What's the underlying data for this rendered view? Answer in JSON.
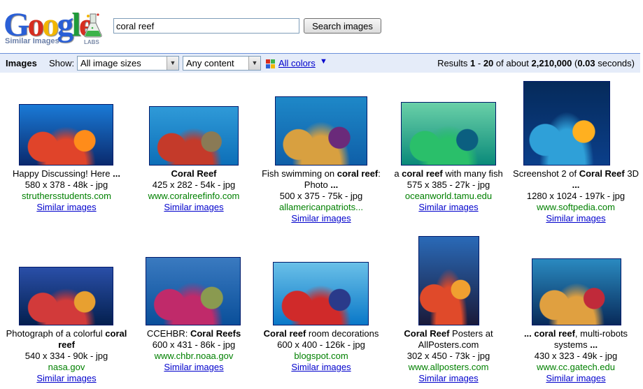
{
  "logo": {
    "word": [
      "G",
      "o",
      "o",
      "g",
      "l",
      "e"
    ],
    "colors": [
      "#2a5fd6",
      "#d62d20",
      "#f2b600",
      "#2a5fd6",
      "#1f9b3a",
      "#d62d20"
    ],
    "subtitle": "Similar Images",
    "labs": "LABS"
  },
  "search": {
    "query": "coral reef",
    "button": "Search images"
  },
  "toolbar": {
    "title": "Images",
    "show_label": "Show:",
    "size_select": "All image sizes",
    "content_select": "Any content",
    "colors_link": "All colors",
    "results_prefix": "Results ",
    "results_from": "1",
    "results_dash": " - ",
    "results_to": "20",
    "results_of": " of about ",
    "results_total": "2,210,000",
    "results_time_open": " (",
    "results_time": "0.03",
    "results_time_close": " seconds)"
  },
  "results": [
    {
      "title": "Happy Discussing! Here ...",
      "meta": "580 x 378 - 48k - jpg",
      "domain": "struthersstudents.com",
      "similar": "Similar images",
      "palette": [
        "#0a2a6e",
        "#e0442a",
        "#ff8c1a",
        "#1a7ad6"
      ]
    },
    {
      "title": "Coral Reef",
      "meta": "425 x 282 - 54k - jpg",
      "domain": "www.coralreefinfo.com",
      "similar": "Similar images",
      "palette": [
        "#0d6fb8",
        "#c43a2a",
        "#8a7a55",
        "#2f9ad8"
      ]
    },
    {
      "title": "Fish swimming on coral reef: Photo ...",
      "meta": "500 x 375 - 75k - jpg",
      "domain": "allamericanpatriots...",
      "similar": "Similar images",
      "palette": [
        "#0f5fa8",
        "#d8a040",
        "#6a2a7a",
        "#1e88c8"
      ]
    },
    {
      "title": "a coral reef with many fish",
      "meta": "575 x 385 - 27k - jpg",
      "domain": "oceanworld.tamu.edu",
      "similar": "Similar images",
      "palette": [
        "#0a8a7a",
        "#2abf6a",
        "#0b5f80",
        "#6ad0a8"
      ]
    },
    {
      "title": "Screenshot 2 of Coral Reef 3D ...",
      "meta": "1280 x 1024 - 197k - jpg",
      "domain": "www.softpedia.com",
      "similar": "Similar images",
      "palette": [
        "#0b3f8a",
        "#2fa0d8",
        "#ffb020",
        "#052a5a"
      ]
    },
    {
      "title": "Photograph of a colorful coral reef",
      "meta": "540 x 334 - 90k - jpg",
      "domain": "nasa.gov",
      "similar": "Similar images",
      "palette": [
        "#04204f",
        "#d23a3a",
        "#e8a030",
        "#2a4fa8"
      ]
    },
    {
      "title": "CCEHBR: Coral Reefs",
      "meta": "600 x 431 - 86k - jpg",
      "domain": "www.chbr.noaa.gov",
      "similar": "Similar images",
      "palette": [
        "#0a4f9a",
        "#c02a6a",
        "#8a9a50",
        "#3a7ac0"
      ]
    },
    {
      "title": "Coral reef room decorations",
      "meta": "600 x 400 - 126k - jpg",
      "domain": "blogspot.com",
      "similar": "Similar images",
      "palette": [
        "#0a78c8",
        "#d02a2a",
        "#2a3a8a",
        "#6ac0e8"
      ]
    },
    {
      "title": "Coral Reef Posters at AllPosters.com",
      "meta": "302 x 450 - 73k - jpg",
      "domain": "www.allposters.com",
      "similar": "Similar images",
      "palette": [
        "#1a1a3a",
        "#e04a2a",
        "#f0a030",
        "#2a6ab8"
      ]
    },
    {
      "title": "... coral reef, multi-robots systems ...",
      "meta": "430 x 323 - 49k - jpg",
      "domain": "www.cc.gatech.edu",
      "similar": "Similar images",
      "palette": [
        "#082a5a",
        "#e0a040",
        "#c02a3a",
        "#2a8ac0"
      ]
    }
  ]
}
